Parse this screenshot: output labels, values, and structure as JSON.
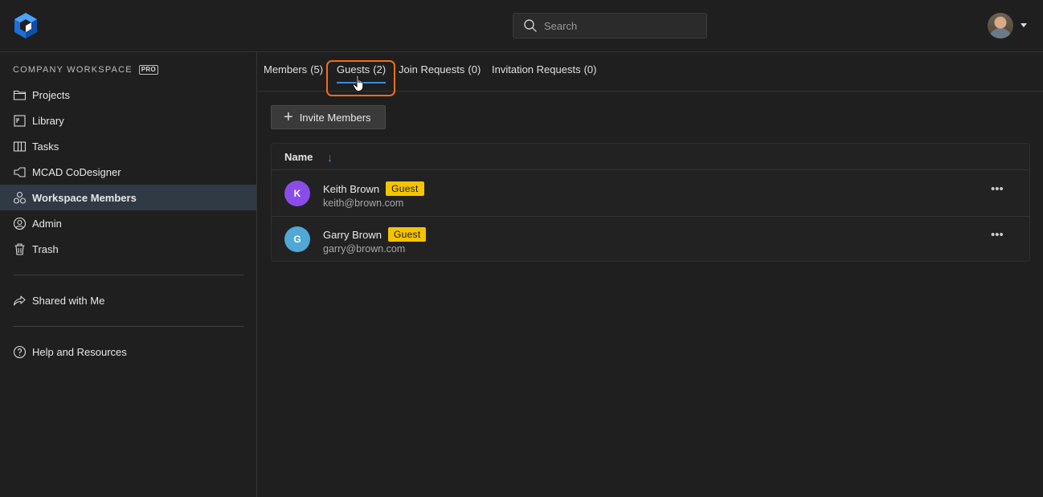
{
  "header": {
    "search_placeholder": "Search"
  },
  "sidebar": {
    "workspace_title": "COMPANY WORKSPACE",
    "plan_badge": "PRO",
    "items": [
      {
        "label": "Projects",
        "icon": "folder-icon"
      },
      {
        "label": "Library",
        "icon": "library-icon"
      },
      {
        "label": "Tasks",
        "icon": "tasks-icon"
      },
      {
        "label": "MCAD CoDesigner",
        "icon": "mcad-icon"
      },
      {
        "label": "Workspace Members",
        "icon": "members-icon",
        "active": true
      },
      {
        "label": "Admin",
        "icon": "admin-icon"
      },
      {
        "label": "Trash",
        "icon": "trash-icon"
      }
    ],
    "shared": {
      "label": "Shared with Me",
      "icon": "share-icon"
    },
    "help": {
      "label": "Help and Resources",
      "icon": "help-icon"
    }
  },
  "tabs": [
    {
      "label": "Members",
      "count": "(5)"
    },
    {
      "label": "Guests",
      "count": "(2)",
      "active": true
    },
    {
      "label": "Join Requests",
      "count": "(0)"
    },
    {
      "label": "Invitation Requests",
      "count": "(0)"
    }
  ],
  "toolbar": {
    "invite_label": "Invite Members"
  },
  "table": {
    "name_header": "Name",
    "rows": [
      {
        "initial": "K",
        "name": "Keith Brown",
        "badge": "Guest",
        "email": "keith@brown.com",
        "avatar_color": "#8a4ce8"
      },
      {
        "initial": "G",
        "name": "Garry Brown",
        "badge": "Guest",
        "email": "garry@brown.com",
        "avatar_color": "#4fa8d5"
      }
    ]
  },
  "colors": {
    "accent": "#3b8fd9",
    "guest_badge": "#f5c400",
    "highlight": "#f26b1d",
    "active_nav": "#2f3a44"
  }
}
